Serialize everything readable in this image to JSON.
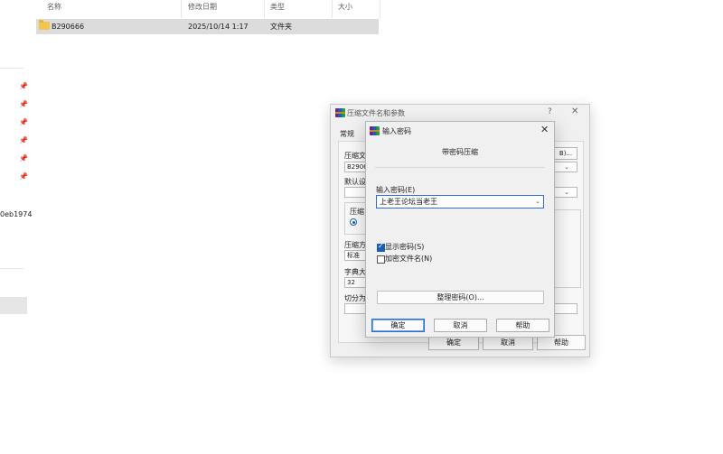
{
  "explorer": {
    "columns": {
      "name": "名称",
      "modified": "修改日期",
      "type": "类型",
      "size": "大小"
    },
    "file": {
      "name": "B290666",
      "modified": "2025/10/14 1:17",
      "type": "文件夹"
    },
    "nav_partial_text": "0eb1974"
  },
  "back_dialog": {
    "title": "压缩文件名和参数",
    "help": "?",
    "close": "✕",
    "tab_general": "常规",
    "archive_name_label": "压缩文",
    "archive_name_value": "B2906",
    "default_settings_label": "默认设",
    "format_group_label": "压缩",
    "method_label": "压缩方",
    "method_value": "标准",
    "dict_label": "字典大",
    "dict_value": "32",
    "split_label": "切分为",
    "browse_label": "B)...",
    "ok": "确定",
    "cancel": "取消",
    "help_button": "帮助"
  },
  "password_dialog": {
    "title": "输入密码",
    "close": "✕",
    "heading": "带密码压缩",
    "password_label": "输入密码(E)",
    "password_value": "上老王论坛当老王",
    "show_password": {
      "label": "显示密码(S)",
      "checked": true
    },
    "encrypt_names": {
      "label": "加密文件名(N)",
      "checked": false
    },
    "organize_button": "整理密码(O)...",
    "ok": "确定",
    "cancel": "取消",
    "help": "帮助"
  },
  "colors": {
    "accent": "#2b6fd6",
    "dialog_bg": "#f0f0f0",
    "selection": "#dcdcdc",
    "folder": "#f2c54c"
  },
  "icons": [
    "pin-icon",
    "folder-icon",
    "winrar-icon",
    "close-icon",
    "chevron-down-icon",
    "help-icon",
    "sort-up-icon"
  ]
}
